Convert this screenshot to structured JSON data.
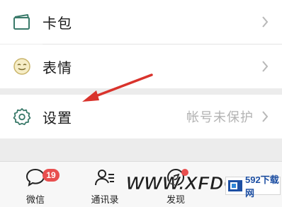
{
  "menu": {
    "items": [
      {
        "label": "卡包",
        "icon": "card-icon"
      },
      {
        "label": "表情",
        "icon": "emoji-icon"
      },
      {
        "label": "设置",
        "icon": "gear-icon",
        "value": "帐号未保护"
      }
    ]
  },
  "tabbar": {
    "tabs": [
      {
        "label": "微信",
        "icon": "chat-icon",
        "badge": "19"
      },
      {
        "label": "通讯录",
        "icon": "contacts-icon"
      },
      {
        "label": "发现",
        "icon": "discover-icon"
      }
    ]
  },
  "watermark": {
    "text": "WWW.XFDOWN",
    "logo_text": "592下载网"
  },
  "colors": {
    "accent_green": "#3a7a6a",
    "badge_red": "#e84f4f",
    "arrow_red": "#d9332c"
  }
}
